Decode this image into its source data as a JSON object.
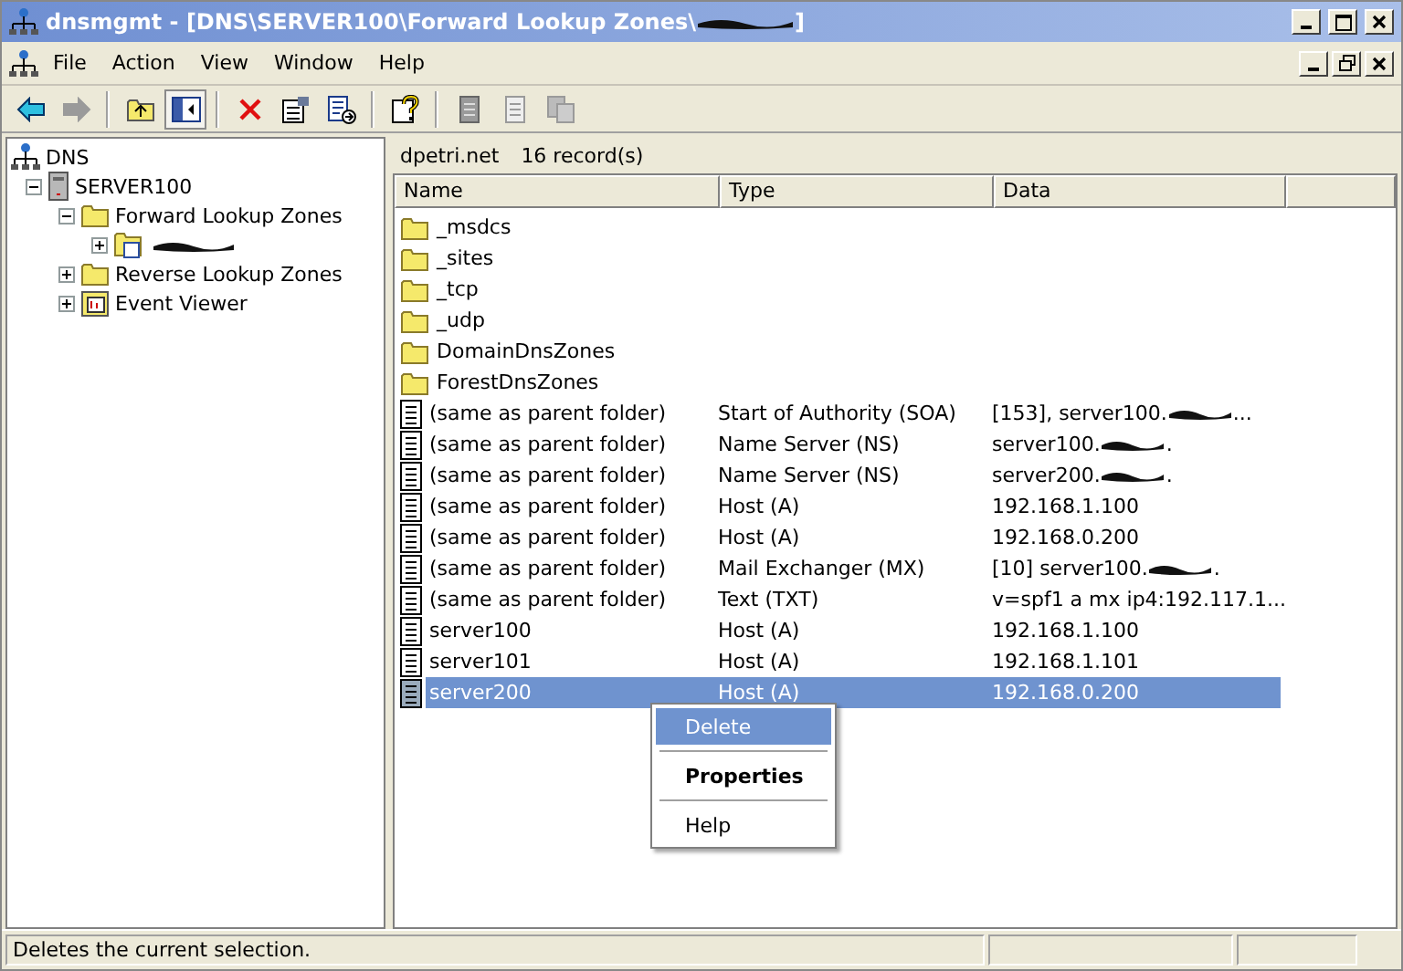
{
  "window": {
    "title": "dnsmgmt - [DNS\\SERVER100\\Forward Lookup Zones\\",
    "title_redacted": true,
    "title_end": "]"
  },
  "menu": [
    "File",
    "Action",
    "View",
    "Window",
    "Help"
  ],
  "toolbar": [
    {
      "kind": "back",
      "disabled": false
    },
    {
      "kind": "forward",
      "disabled": true
    },
    {
      "kind": "separator"
    },
    {
      "kind": "up",
      "disabled": false
    },
    {
      "kind": "tree",
      "disabled": false,
      "pressed": true
    },
    {
      "kind": "separator"
    },
    {
      "kind": "delete",
      "disabled": false
    },
    {
      "kind": "properties",
      "disabled": false
    },
    {
      "kind": "export",
      "disabled": false
    },
    {
      "kind": "separator"
    },
    {
      "kind": "help",
      "disabled": false
    },
    {
      "kind": "separator"
    },
    {
      "kind": "doc",
      "disabled": true
    },
    {
      "kind": "notes",
      "disabled": true
    },
    {
      "kind": "copy",
      "disabled": true
    }
  ],
  "tree": [
    {
      "label": "DNS",
      "kind": "dns",
      "children": [
        {
          "label": "SERVER100",
          "kind": "server",
          "expanded": true,
          "children": [
            {
              "label": "Forward Lookup Zones",
              "kind": "folder",
              "expanded": true,
              "children": [
                {
                  "kind": "zone",
                  "redacted": true,
                  "expanded": false
                }
              ]
            },
            {
              "label": "Reverse Lookup Zones",
              "kind": "folder",
              "expanded": false
            },
            {
              "label": "Event Viewer",
              "kind": "events",
              "expanded": false
            }
          ]
        }
      ]
    }
  ],
  "pane": {
    "zone": "dpetri.net",
    "count": "16 record(s)"
  },
  "columns": [
    "Name",
    "Type",
    "Data"
  ],
  "rows": [
    {
      "kind": "folder",
      "name": "_msdcs",
      "selected": false
    },
    {
      "kind": "folder",
      "name": "_sites",
      "selected": false
    },
    {
      "kind": "folder",
      "name": "_tcp",
      "selected": false
    },
    {
      "kind": "folder",
      "name": "_udp",
      "selected": false
    },
    {
      "kind": "folder",
      "name": "DomainDnsZones",
      "selected": false
    },
    {
      "kind": "folder",
      "name": "ForestDnsZones",
      "selected": false
    },
    {
      "kind": "record",
      "name": "(same as parent folder)",
      "type": "Start of Authority (SOA)",
      "data": "[153], server100.",
      "redacted": true,
      "data_end": "...",
      "selected": false
    },
    {
      "kind": "record",
      "name": "(same as parent folder)",
      "type": "Name Server (NS)",
      "data": "server100.",
      "redacted": true,
      "data_end": ".",
      "selected": false
    },
    {
      "kind": "record",
      "name": "(same as parent folder)",
      "type": "Name Server (NS)",
      "data": "server200.",
      "redacted": true,
      "data_end": ".",
      "selected": false
    },
    {
      "kind": "record",
      "name": "(same as parent folder)",
      "type": "Host (A)",
      "data": "192.168.1.100",
      "selected": false
    },
    {
      "kind": "record",
      "name": "(same as parent folder)",
      "type": "Host (A)",
      "data": "192.168.0.200",
      "selected": false
    },
    {
      "kind": "record",
      "name": "(same as parent folder)",
      "type": "Mail Exchanger (MX)",
      "data": "[10]  server100.",
      "redacted": true,
      "data_end": ".",
      "selected": false
    },
    {
      "kind": "record",
      "name": "(same as parent folder)",
      "type": "Text (TXT)",
      "data": "v=spf1 a mx ip4:192.117.1...",
      "selected": false
    },
    {
      "kind": "record",
      "name": "server100",
      "type": "Host (A)",
      "data": "192.168.1.100",
      "selected": false
    },
    {
      "kind": "record",
      "name": "server101",
      "type": "Host (A)",
      "data": "192.168.1.101",
      "selected": false
    },
    {
      "kind": "record",
      "name": "server200",
      "type": "Host (A)",
      "data": "192.168.0.200",
      "selected": true
    }
  ],
  "context_menu": [
    {
      "kind": "item",
      "label": "Delete",
      "selected": true,
      "default": false
    },
    {
      "kind": "separator"
    },
    {
      "kind": "item",
      "label": "Properties",
      "selected": false,
      "default": true
    },
    {
      "kind": "separator"
    },
    {
      "kind": "item",
      "label": "Help",
      "selected": false,
      "default": false
    }
  ],
  "status_bar": {
    "text": "Deletes the current selection."
  }
}
